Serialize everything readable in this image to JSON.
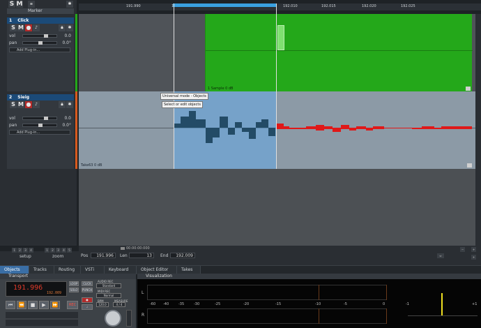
{
  "toolbar": {
    "solo": "S",
    "mute": "M"
  },
  "marker": {
    "label": "Marker"
  },
  "tracks": [
    {
      "number": "1",
      "name": "Click",
      "solo": "S",
      "mute": "M",
      "vol_label": "vol",
      "vol_value": "0.0",
      "pan_label": "pan",
      "pan_value": "0.0°",
      "plugin_placeholder": "Add Plug-in...",
      "clip_label": "1 Sample  0 dB"
    },
    {
      "number": "2",
      "name": "Sieig",
      "solo": "S",
      "mute": "M",
      "vol_label": "vol",
      "vol_value": "0.0",
      "pan_label": "pan",
      "pan_value": "0.0°",
      "plugin_placeholder": "Add Plug-in...",
      "clip_label": "Take63  0 dB"
    }
  ],
  "ruler": {
    "ticks": [
      "191.990",
      "191.995",
      "192.000",
      "192.005",
      "192.010",
      "192.015",
      "192.020",
      "192.025"
    ]
  },
  "tooltip": {
    "line1": "Universal mode - Objects",
    "line2": "Select or edit objects"
  },
  "status": {
    "setup_label": "setup",
    "zoom_label": "zoom",
    "setup_buttons": [
      "1",
      "2",
      "3",
      "4"
    ],
    "zoom_buttons": [
      "1",
      "2",
      "3",
      "4",
      "5"
    ],
    "time": "00:00:00:000",
    "pos_label": "Pos",
    "pos_value": "191.996",
    "len_label": "Len",
    "len_value": "13",
    "end_label": "End",
    "end_value": "192.009"
  },
  "tabs": [
    "Objects",
    "Tracks",
    "Routing",
    "VSTi",
    "Keyboard",
    "Object Editor",
    "Takes"
  ],
  "active_tab": "Objects",
  "transport": {
    "title": "Transport",
    "position": "191.996",
    "sub_position": "192.009",
    "loop": "LOOP",
    "solo": "SOLO",
    "click": "CLICK",
    "punch": "PUNCH",
    "audio_rec": "AUDIO REC",
    "standard": "Standard",
    "midi_rec": "MIDI REC",
    "normal": "Normal",
    "bpm_label": "BPM",
    "bpm_value": "120.0",
    "measure_label": "MEASURE",
    "measure_value": "4 / 4",
    "record": "REC"
  },
  "visualization": {
    "title": "Visualization",
    "db_scale": [
      "-60",
      "-40",
      "-35",
      "-30",
      "-25",
      "-20",
      "-15",
      "-10",
      "-5",
      "0"
    ],
    "channel_left": "L",
    "channel_right": "R",
    "corr_left": "-1",
    "corr_right": "+1"
  },
  "colors": {
    "accent": "#3a6ea5",
    "clip_green": "#24a81a",
    "selection_blue": "#64aae6",
    "rec_red": "#b22b2b"
  }
}
